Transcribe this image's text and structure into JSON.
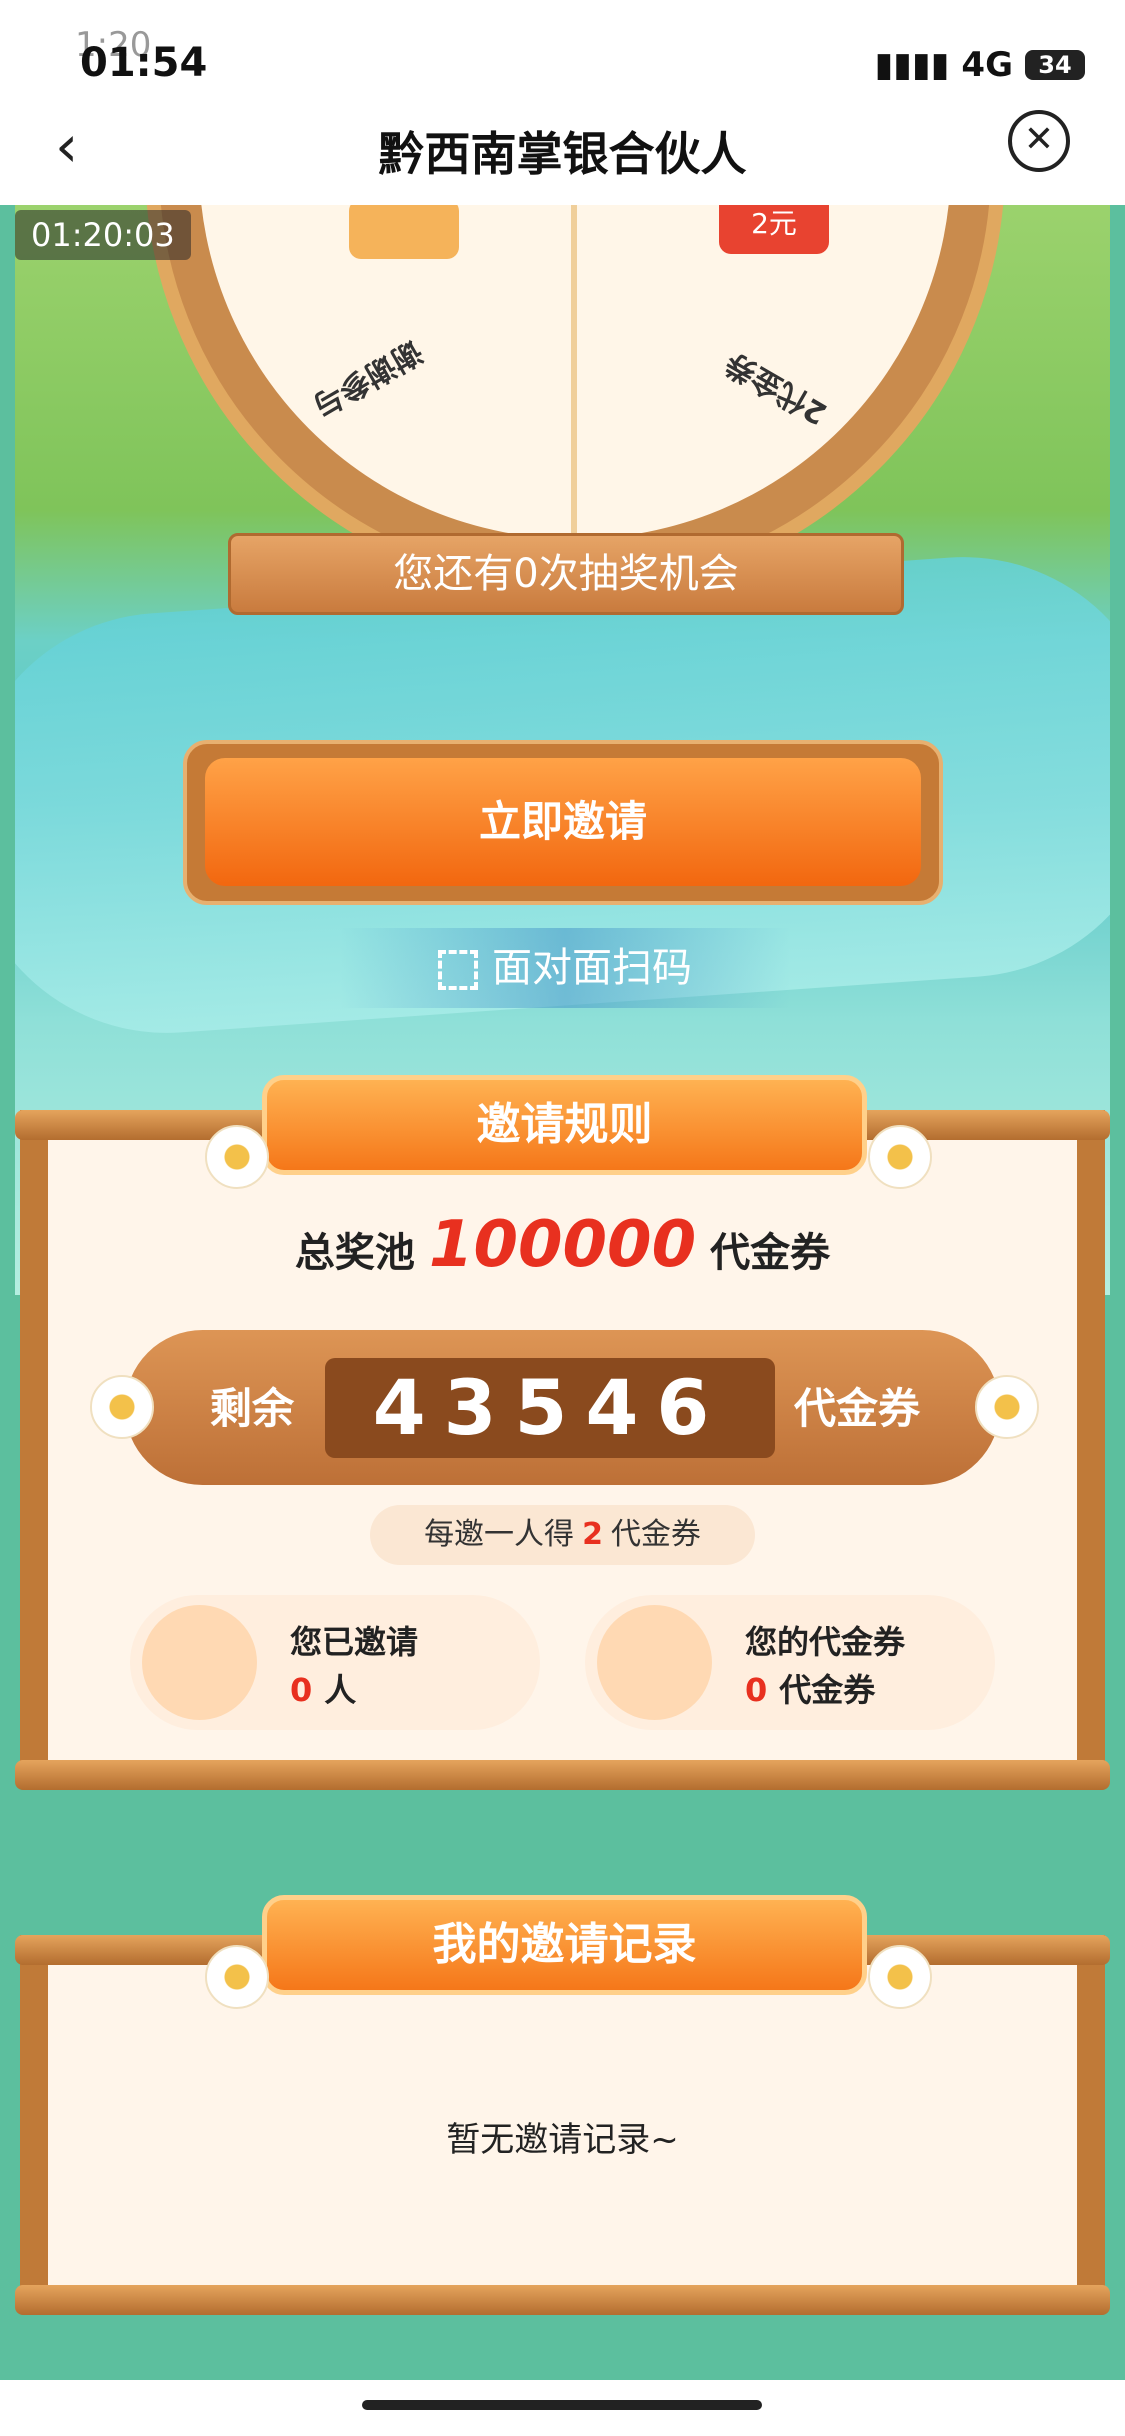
{
  "status_bar": {
    "time": "01:54",
    "ghost_time": "1:20",
    "network": "4G",
    "battery": "34"
  },
  "nav": {
    "title": "黔西南掌银合伙人",
    "back_icon": "chevron-left-icon",
    "close_icon": "close-circle-icon"
  },
  "timer": "01:20:03",
  "wheel": {
    "prize_left": "谢谢参与",
    "prize_right": "2代金券",
    "prize_right_icon_text": "2元"
  },
  "lottery": {
    "chances_text": "您还有0次抽奖机会"
  },
  "actions": {
    "invite_now": "立即邀请",
    "face_scan": "面对面扫码"
  },
  "rules": {
    "title": "邀请规则",
    "pool_label": "总奖池",
    "pool_amount": "100000",
    "pool_unit": "代金券",
    "remain_label": "剩余",
    "remain_amount": "43546",
    "remain_unit": "代金券",
    "per_invite_prefix": "每邀一人得",
    "per_invite_amount": "2",
    "per_invite_unit": "代金券",
    "invited_title": "您已邀请",
    "invited_value": "0",
    "invited_unit": "人",
    "coupons_title": "您的代金券",
    "coupons_value": "0",
    "coupons_unit": "代金券"
  },
  "records": {
    "title": "我的邀请记录",
    "empty_text": "暂无邀请记录~"
  }
}
